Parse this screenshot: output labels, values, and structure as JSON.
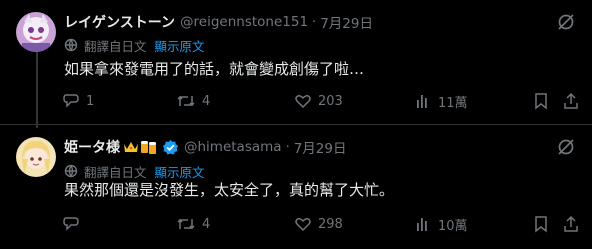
{
  "tweets": [
    {
      "name": "レイゲンストーン",
      "handle": "@reigennstone151",
      "date": "7月29日",
      "translate_label": "翻譯自日文",
      "translate_link": "顯示原文",
      "text": "如果拿來發電用了的話，就會變成創傷了啦…",
      "replies": "1",
      "retweets": "4",
      "likes": "203",
      "views": "11萬"
    },
    {
      "name": "姫ータ様",
      "handle": "@himetasama",
      "date": "7月29日",
      "translate_label": "翻譯自日文",
      "translate_link": "顯示原文",
      "text": "果然那個還是沒發生，太安全了，真的幫了大忙。",
      "replies": "",
      "retweets": "4",
      "likes": "298",
      "views": "10萬"
    }
  ],
  "colors": {
    "accent": "#1d9bf0",
    "muted": "#71767b",
    "text": "#e7e9ea",
    "bg": "#000000"
  },
  "icons": [
    "grok-icon",
    "translate-icon",
    "reply-icon",
    "retweet-icon",
    "like-icon",
    "views-icon",
    "bookmark-icon",
    "share-icon",
    "crown-icon",
    "beer-icon",
    "verified-badge-icon"
  ]
}
